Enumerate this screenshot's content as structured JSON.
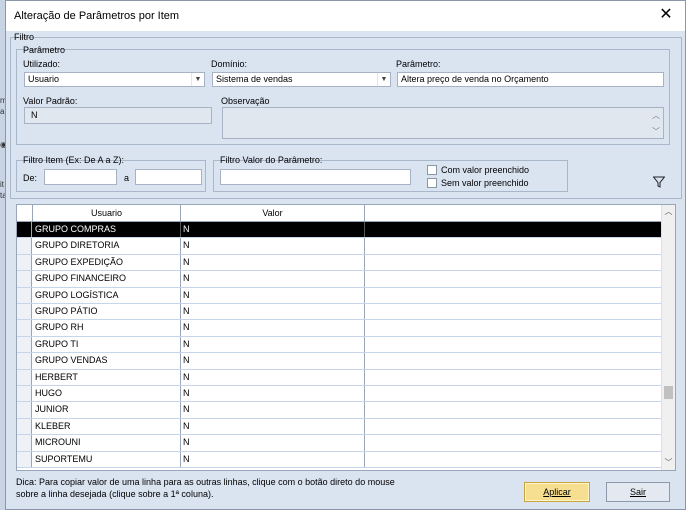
{
  "window": {
    "title": "Alteração de Parâmetros por Item",
    "close": "✕"
  },
  "filtro": {
    "legend": "Filtro",
    "parametro_group": "Parâmetro",
    "utilizado_label": "Utilizado:",
    "utilizado_value": "Usuario",
    "dominio_label": "Domínio:",
    "dominio_value": "Sistema de vendas",
    "parametro_label": "Parâmetro:",
    "parametro_value": "Altera preço de venda no Orçamento",
    "valor_padrao_label": "Valor Padrão:",
    "valor_padrao_value": "N",
    "observacao_label": "Observação"
  },
  "filtro_item": {
    "label": "Filtro Item (Ex: De A a Z):",
    "de_label": "De:",
    "de_value": "",
    "a_label": "a",
    "a_value": ""
  },
  "filtro_valor": {
    "label": "Filtro Valor do Parâmetro:",
    "value": "",
    "com_valor": "Com valor preenchido",
    "sem_valor": "Sem valor preenchido"
  },
  "grid": {
    "columns": [
      "Usuario",
      "Valor"
    ],
    "rows": [
      {
        "usuario": "GRUPO COMPRAS",
        "valor": "N"
      },
      {
        "usuario": "GRUPO DIRETORIA",
        "valor": "N"
      },
      {
        "usuario": "GRUPO EXPEDIÇÃO",
        "valor": "N"
      },
      {
        "usuario": "GRUPO FINANCEIRO",
        "valor": "N"
      },
      {
        "usuario": "GRUPO LOGÍSTICA",
        "valor": "N"
      },
      {
        "usuario": "GRUPO PÁTIO",
        "valor": "N"
      },
      {
        "usuario": "GRUPO RH",
        "valor": "N"
      },
      {
        "usuario": "GRUPO TI",
        "valor": "N"
      },
      {
        "usuario": "GRUPO VENDAS",
        "valor": "N"
      },
      {
        "usuario": "HERBERT",
        "valor": "N"
      },
      {
        "usuario": "HUGO",
        "valor": "N"
      },
      {
        "usuario": "JUNIOR",
        "valor": "N"
      },
      {
        "usuario": "KLEBER",
        "valor": "N"
      },
      {
        "usuario": "MICROUNI",
        "valor": "N"
      },
      {
        "usuario": "SUPORTEMU",
        "valor": "N"
      }
    ]
  },
  "footer": {
    "tip_line1": "Dica: Para copiar valor de uma linha para as outras linhas, clique com o botão direto do mouse",
    "tip_line2": "sobre a linha desejada (clique sobre a 1ª coluna).",
    "aplicar": "Aplicar",
    "sair": "Sair"
  },
  "colors": {
    "accent": "#f6df90",
    "panel": "#dae3f0",
    "selected_row": "#000000"
  }
}
